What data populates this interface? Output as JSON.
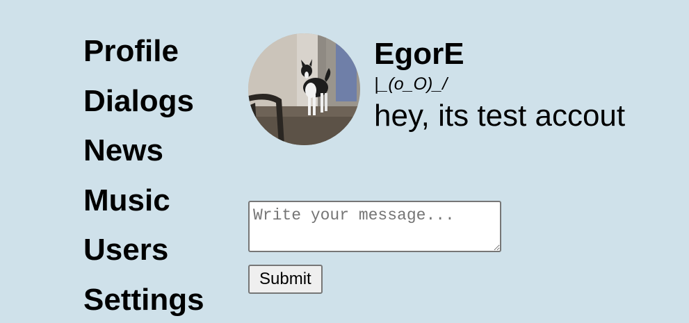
{
  "nav": {
    "items": [
      {
        "label": "Profile"
      },
      {
        "label": "Dialogs"
      },
      {
        "label": "News"
      },
      {
        "label": "Music"
      },
      {
        "label": "Users"
      },
      {
        "label": "Settings"
      }
    ]
  },
  "profile": {
    "name": "EgorE",
    "status": "|_(o_O)_/",
    "bio": "hey, its test accout"
  },
  "composer": {
    "placeholder": "Write your message...",
    "value": "",
    "submit_label": "Submit"
  }
}
